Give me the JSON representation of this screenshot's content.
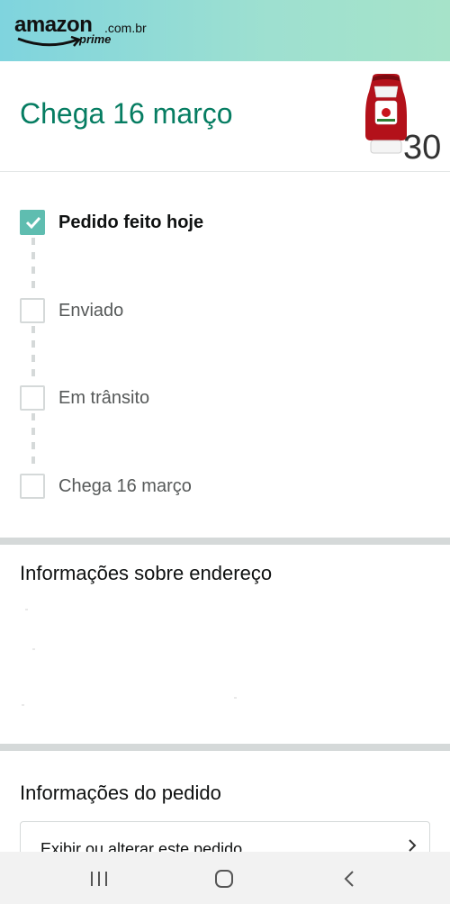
{
  "header": {
    "logo_word": "amazon",
    "logo_domain": ".com.br",
    "logo_sub": "prime",
    "brand_gradient": [
      "#7fd4de",
      "#a6e3c9"
    ]
  },
  "arrival": {
    "title": "Chega 16 março",
    "product_image": "heinz-tomato-ketchup-bottle",
    "quantity": "30"
  },
  "tracking": {
    "steps": [
      {
        "label": "Pedido feito hoje",
        "checked": true
      },
      {
        "label": "Enviado",
        "checked": false
      },
      {
        "label": "Em trânsito",
        "checked": false
      },
      {
        "label": "Chega 16 março",
        "checked": false
      }
    ],
    "accent_color": "#5fbdb0"
  },
  "address_section": {
    "title": "Informações sobre endereço"
  },
  "order_section": {
    "title": "Informações do pedido",
    "link_label": "Exibir ou alterar este pedido"
  },
  "android_nav": {
    "icons": [
      "recent-apps-icon",
      "home-icon",
      "back-icon"
    ]
  },
  "colors": {
    "title_teal": "#067d62",
    "check_fill": "#5fbdb0",
    "divider": "#d5d9d9"
  }
}
